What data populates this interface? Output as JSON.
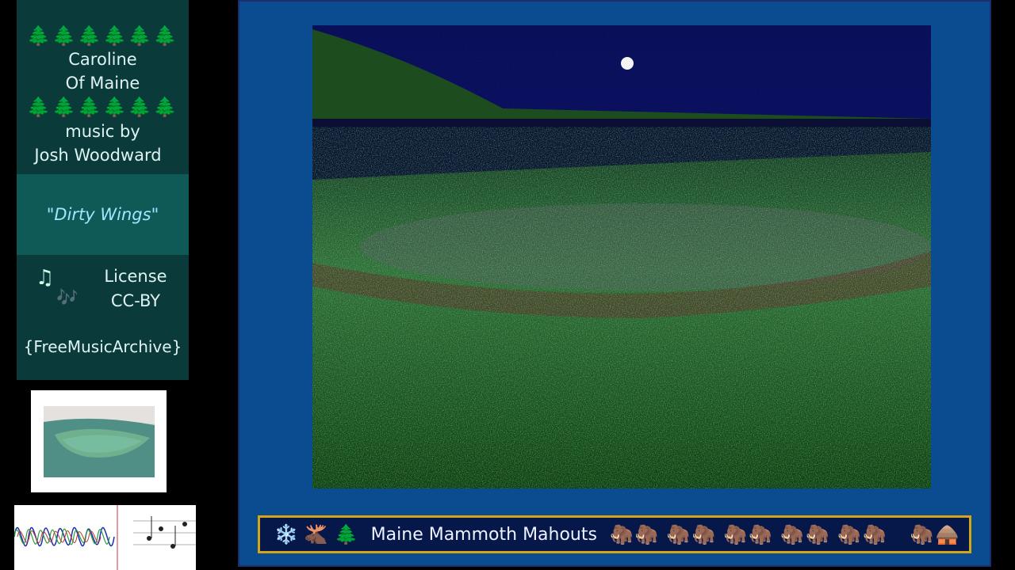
{
  "sidebar": {
    "trees_row": "🌲🌲🌲🌲🌲🌲",
    "artist_line1": "Caroline",
    "artist_line2": "Of Maine",
    "music_by": "music by",
    "composer": "Josh Woodward",
    "song_title": "\"Dirty Wings\"",
    "note_icon_1": "♫",
    "note_icon_2": "🎶",
    "license_label": "License",
    "license_value": "CC-BY",
    "source": "{FreeMusicArchive}"
  },
  "bottom_bar": {
    "icons_left": [
      "❄️",
      "🫎",
      "🌲"
    ],
    "title": "Maine Mammoth Mahouts",
    "mammoths": [
      "🦣",
      "🦣",
      "🦣",
      "🦣",
      "🦣",
      "🦣",
      "🦣",
      "🦣",
      "🦣",
      "🦣"
    ],
    "icons_right": [
      "🦣",
      "🛖"
    ]
  },
  "colors": {
    "panel_blue": "#0a4c8f",
    "bar_border": "#d4a514",
    "night_sky": "#0a0f5a",
    "grass": "#2ea043"
  }
}
